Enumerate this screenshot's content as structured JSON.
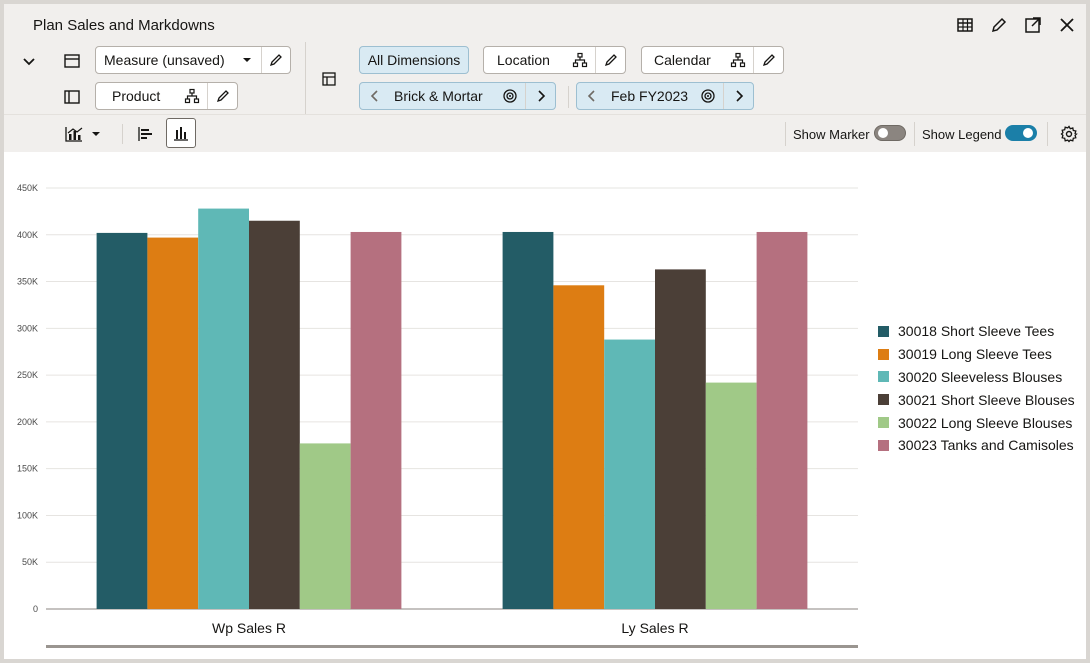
{
  "window": {
    "title": "Plan Sales and Markdowns"
  },
  "toolbar": {
    "measure_label": "Measure (unsaved)",
    "product_label": "Product",
    "all_dimensions_label": "All Dimensions",
    "location_label": "Location",
    "calendar_label": "Calendar",
    "location_value": "Brick & Mortar",
    "calendar_value": "Feb FY2023",
    "show_marker_label": "Show Marker",
    "show_marker_on": false,
    "show_legend_label": "Show Legend",
    "show_legend_on": true
  },
  "chart_data": {
    "type": "bar",
    "categories": [
      "Wp Sales R",
      "Ly Sales R"
    ],
    "series": [
      {
        "name": "30018 Short Sleeve Tees",
        "color": "#235c66",
        "values": [
          402000,
          403000
        ]
      },
      {
        "name": "30019 Long Sleeve Tees",
        "color": "#dd7d13",
        "values": [
          397000,
          346000
        ]
      },
      {
        "name": "30020 Sleeveless Blouses",
        "color": "#5fb8b6",
        "values": [
          428000,
          288000
        ]
      },
      {
        "name": "30021 Short Sleeve Blouses",
        "color": "#4b3f37",
        "values": [
          415000,
          363000
        ]
      },
      {
        "name": "30022 Long Sleeve Blouses",
        "color": "#a0c987",
        "values": [
          177000,
          242000
        ]
      },
      {
        "name": "30023 Tanks and Camisoles",
        "color": "#b5707f",
        "values": [
          403000,
          403000
        ]
      }
    ],
    "yticks": [
      "0",
      "50K",
      "100K",
      "150K",
      "200K",
      "250K",
      "300K",
      "350K",
      "400K",
      "450K"
    ],
    "ylim": [
      0,
      450000
    ],
    "grid": true,
    "legend_position": "right"
  }
}
